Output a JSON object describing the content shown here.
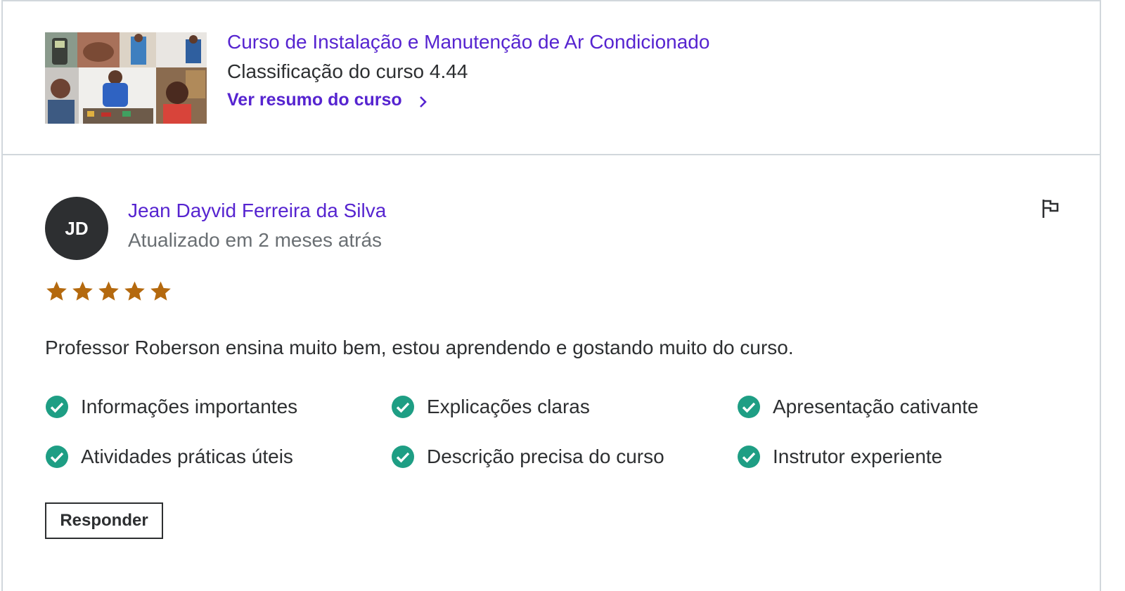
{
  "course": {
    "title": "Curso de Instalação e Manutenção de Ar Condicionado",
    "rating_text": "Classificação do curso 4.44",
    "summary_link": "Ver resumo do curso",
    "link_color": "#5624d0"
  },
  "review": {
    "avatar_initials": "JD",
    "reviewer_name": "Jean Dayvid Ferreira da Silva",
    "updated": "Atualizado em 2 meses atrás",
    "rating": 5,
    "rating_max": 5,
    "star_color": "#b4690e",
    "text": "Professor Roberson ensina muito bem, estou aprendendo e gostando muito do curso.",
    "features": [
      "Informações importantes",
      "Explicações claras",
      "Apresentação cativante",
      "Atividades práticas úteis",
      "Descrição precisa do curso",
      "Instrutor experiente"
    ],
    "check_color": "#1e9e84",
    "reply_label": "Responder"
  },
  "icons": {
    "flag": "flag-icon",
    "chevron": "chevron-right-icon",
    "check": "check-circle-icon",
    "star": "star-icon"
  }
}
